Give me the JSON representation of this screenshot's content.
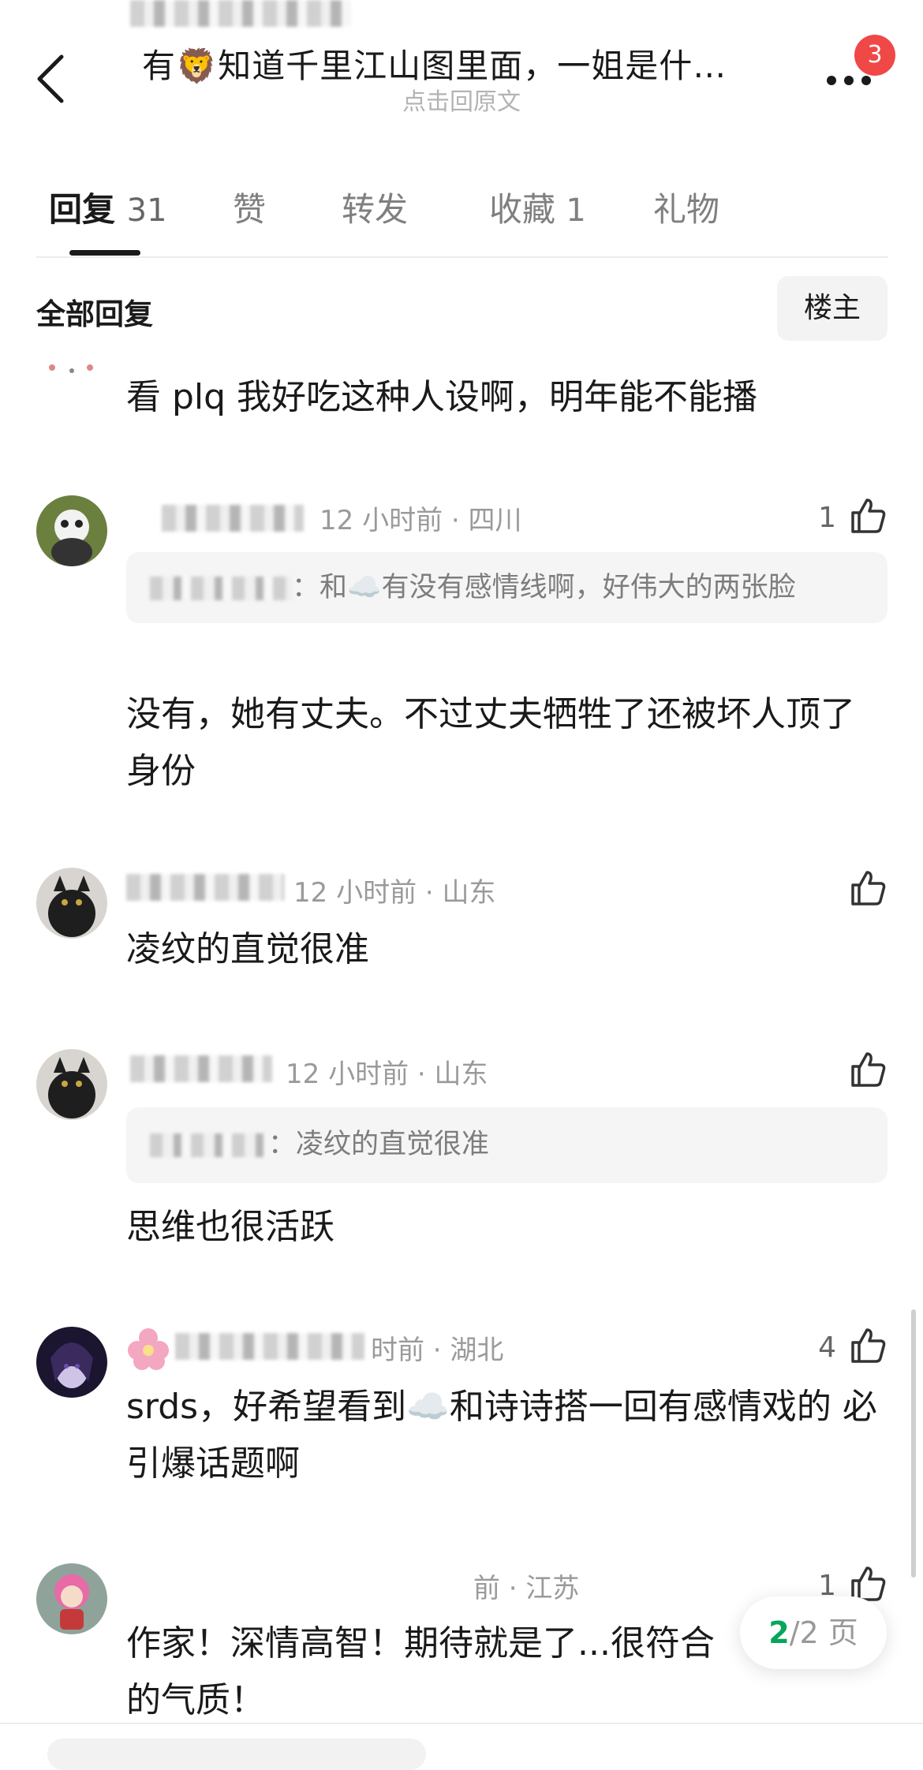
{
  "header": {
    "title": "有🦁知道千里江山图里面，一姐是什…",
    "subtitle": "点击回原文",
    "badge_count": "3"
  },
  "tabs": [
    {
      "label": "回复",
      "count": "31",
      "active": true
    },
    {
      "label": "赞",
      "count": ""
    },
    {
      "label": "转发",
      "count": ""
    },
    {
      "label": "收藏",
      "count": "1"
    },
    {
      "label": "礼物",
      "count": ""
    }
  ],
  "section": {
    "title": "全部回复",
    "owner_button": "楼主"
  },
  "comments": [
    {
      "text": "看 plq 我好吃这种人设啊，明年能不能播"
    },
    {
      "meta": "12 小时前 · 四川",
      "likes": "1",
      "quote": "：和☁️有没有感情线啊，好伟大的两张脸",
      "text": "没有，她有丈夫。不过丈夫牺牲了还被坏人顶了身份"
    },
    {
      "meta": "12 小时前 · 山东",
      "likes": "",
      "text": "凌纹的直觉很准"
    },
    {
      "meta": "12 小时前 · 山东",
      "likes": "",
      "quote": "：凌纹的直觉很准",
      "text": "思维也很活跃"
    },
    {
      "meta": "时前 · 湖北",
      "likes": "4",
      "text": "srds，好希望看到☁️和诗诗搭一回有感情戏的 必引爆话题啊"
    },
    {
      "meta": "前 · 江苏",
      "likes": "1",
      "text": "作家！深情高智！期待就是了...很符合的气质！"
    }
  ],
  "pager": {
    "current": "2",
    "total": "/2 页"
  },
  "colors": {
    "accent_green": "#07a65a",
    "badge_red": "#f04747"
  }
}
